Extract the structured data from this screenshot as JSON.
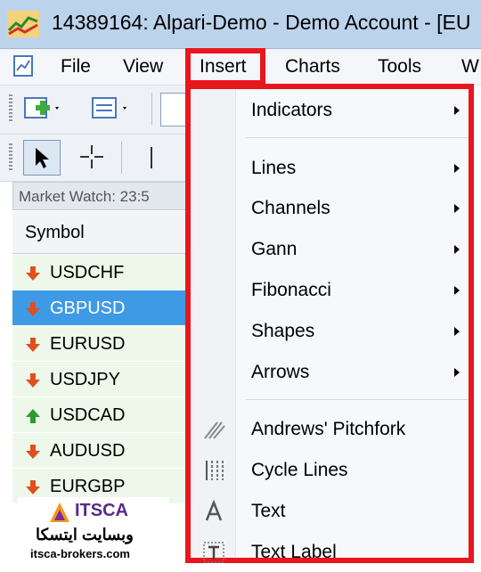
{
  "window": {
    "title": "14389164: Alpari-Demo - Demo Account - [EU"
  },
  "menubar": {
    "items": [
      "File",
      "View",
      "Insert",
      "Charts",
      "Tools",
      "W"
    ]
  },
  "market_watch": {
    "header": "Market Watch: 23:5",
    "column_symbol": "Symbol",
    "rows": [
      {
        "symbol": "USDCHF",
        "direction": "down"
      },
      {
        "symbol": "GBPUSD",
        "direction": "down",
        "selected": true
      },
      {
        "symbol": "EURUSD",
        "direction": "down"
      },
      {
        "symbol": "USDJPY",
        "direction": "down"
      },
      {
        "symbol": "USDCAD",
        "direction": "up"
      },
      {
        "symbol": "AUDUSD",
        "direction": "down"
      },
      {
        "symbol": "EURGBP",
        "direction": "down"
      }
    ]
  },
  "insert_menu": {
    "group1": [
      "Indicators"
    ],
    "group2": [
      "Lines",
      "Channels",
      "Gann",
      "Fibonacci",
      "Shapes",
      "Arrows"
    ],
    "group3": [
      "Andrews' Pitchfork",
      "Cycle Lines",
      "Text",
      "Text Label"
    ]
  },
  "watermark": {
    "brand": "ITSCA",
    "arabic": "وبسایت ایتسکا",
    "site": "itsca-brokers.com"
  },
  "colors": {
    "highlight_border": "#e8161d",
    "selection": "#3f9ae6",
    "down_arrow": "#e0501e",
    "up_arrow": "#2c9a2c"
  }
}
